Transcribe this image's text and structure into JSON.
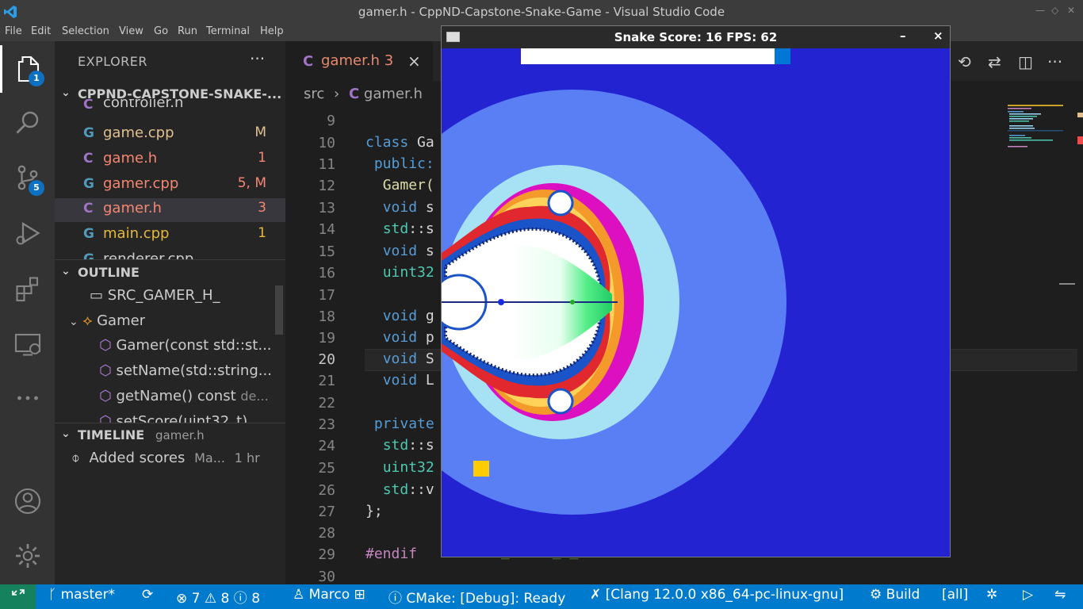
{
  "window": {
    "title": "gamer.h - CppND-Capstone-Snake-Game - Visual Studio Code"
  },
  "menu": [
    "File",
    "Edit",
    "Selection",
    "View",
    "Go",
    "Run",
    "Terminal",
    "Help"
  ],
  "activity": {
    "explorer_badge": "1",
    "scm_badge": "5"
  },
  "explorer": {
    "header": "EXPLORER",
    "more": "···",
    "root": "CPPND-CAPSTONE-SNAKE-...",
    "files": [
      {
        "icon": "C",
        "name": "controller.h",
        "status": ""
      },
      {
        "icon": "G",
        "name": "game.cpp",
        "status": "M"
      },
      {
        "icon": "C",
        "name": "game.h",
        "status": "1"
      },
      {
        "icon": "G",
        "name": "gamer.cpp",
        "status": "5, M"
      },
      {
        "icon": "C",
        "name": "gamer.h",
        "status": "3"
      },
      {
        "icon": "G",
        "name": "main.cpp",
        "status": "1"
      },
      {
        "icon": "G",
        "name": "renderer.cpp",
        "status": ""
      }
    ]
  },
  "outline": {
    "header": "OUTLINE",
    "items": [
      "SRC_GAMER_H_",
      "Gamer",
      "Gamer(const std::st...",
      "setName(std::string...",
      "getName() const",
      "setScore(uint32_t)"
    ],
    "item_detail": "de..."
  },
  "timeline": {
    "header": "TIMELINE",
    "file": "gamer.h",
    "entry": "Added scores",
    "author": "Ma...",
    "age": "1 hr"
  },
  "editor": {
    "tab": {
      "icon": "C",
      "name": "gamer.h",
      "problems": "3",
      "close": "×"
    },
    "breadcrumb": [
      "src",
      "gamer.h"
    ],
    "line_numbers": [
      "9",
      "10",
      "11",
      "12",
      "13",
      "14",
      "15",
      "16",
      "17",
      "18",
      "19",
      "20",
      "21",
      "22",
      "23",
      "24",
      "25",
      "26",
      "27",
      "28",
      "29",
      "30"
    ],
    "current_line": "20"
  },
  "game_window": {
    "title": "Snake Score: 16 FPS: 62",
    "minimize": "–",
    "close": "×"
  },
  "status": {
    "branch": "master*",
    "errors": "7",
    "warnings": "8",
    "infos": "8",
    "user": "Marco",
    "cmake": "CMake: [Debug]: Ready",
    "kit": "[Clang 12.0.0 x86_64-pc-linux-gnu]",
    "build": "Build",
    "target": "[all]"
  },
  "colors": {
    "accent": "#007acc",
    "remote": "#16825d",
    "modified": "#e2c08d",
    "error": "#f48771"
  }
}
